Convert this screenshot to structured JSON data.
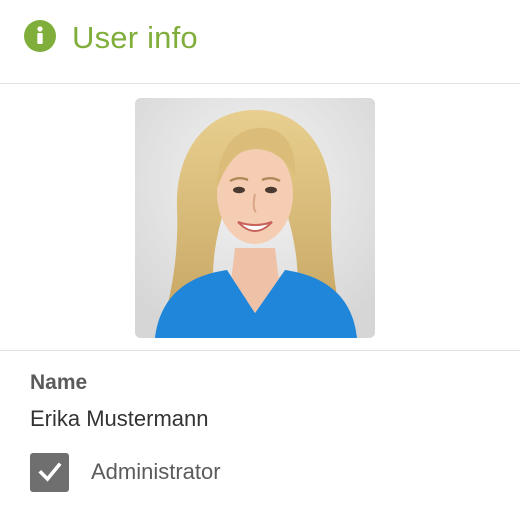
{
  "header": {
    "icon": "info-icon",
    "title": "User info",
    "accent_color": "#7fae3a"
  },
  "user": {
    "photo_icon": "user-photo",
    "name_label": "Name",
    "name_value": "Erika Mustermann",
    "administrator_label": "Administrator",
    "administrator_checked": true,
    "checkbox_color": "#6f6f6f"
  }
}
